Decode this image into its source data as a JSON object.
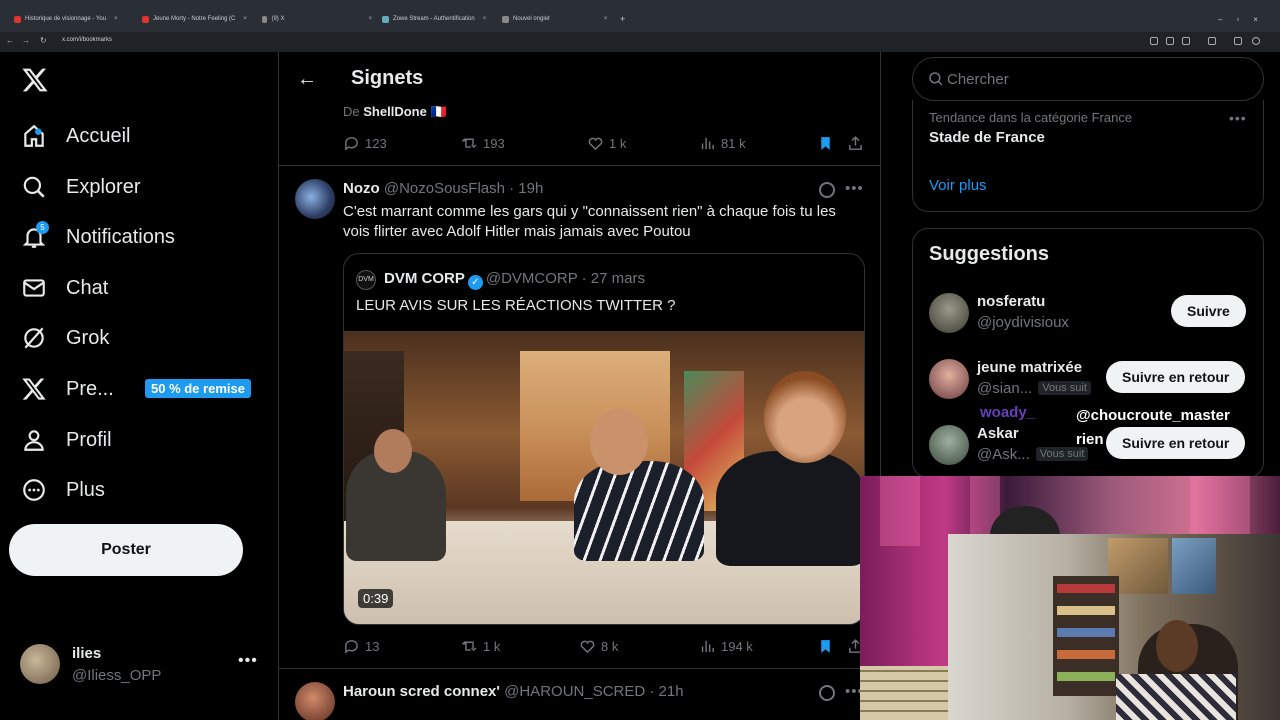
{
  "browser": {
    "tabs": [
      {
        "label": "Historique de visionnage - You",
        "color": "#e33"
      },
      {
        "label": "Jeune Morty - Notre Feeling (C",
        "color": "#e33"
      },
      {
        "label": "(9) X",
        "color": "#888"
      },
      {
        "label": "Zowe Stream - Authentification",
        "color": "#6ab"
      },
      {
        "label": "Nouvel onglet",
        "color": "#888"
      }
    ],
    "url": "x.com/i/bookmarks"
  },
  "sidebar": {
    "items": [
      {
        "label": "Accueil",
        "icon": "home-icon"
      },
      {
        "label": "Explorer",
        "icon": "search-icon"
      },
      {
        "label": "Notifications",
        "icon": "bell-icon"
      },
      {
        "label": "Chat",
        "icon": "mail-icon"
      },
      {
        "label": "Grok",
        "icon": "grok-icon"
      },
      {
        "label": "Pre...",
        "icon": "x-logo-icon"
      },
      {
        "label": "Profil",
        "icon": "person-icon"
      },
      {
        "label": "Plus",
        "icon": "more-circle-icon"
      }
    ],
    "notif_count": "5",
    "premium_badge": "50 % de remise",
    "post_button": "Poster",
    "account": {
      "name": "ilies",
      "handle": "@Iliess_OPP"
    }
  },
  "center": {
    "title": "Signets",
    "prev_tweet": {
      "from_prefix": "De",
      "from_name": "ShellDone",
      "flag": "🇫🇷",
      "replies": "123",
      "retweets": "193",
      "likes": "1 k",
      "views": "81 k"
    },
    "tweet": {
      "name": "Nozo",
      "handle_time": "@NozoSousFlash · 19h",
      "text": "C'est marrant comme les gars qui y \"connaissent rien\" à chaque fois tu les vois flirter avec Adolf Hitler mais jamais avec Poutou",
      "quote": {
        "name": "DVM CORP",
        "handle_time": "@DVMCORP · 27 mars",
        "avatar_text": "DVM",
        "text": "LEUR AVIS SUR LES RÉACTIONS TWITTER ?",
        "duration": "0:39"
      },
      "replies": "13",
      "retweets": "1 k",
      "likes": "8 k",
      "views": "194 k"
    },
    "next_tweet": {
      "name": "Haroun scred connex'",
      "handle_time": "@HAROUN_SCRED · 21h"
    }
  },
  "right": {
    "search_placeholder": "Chercher",
    "trend": {
      "category": "Tendance dans la catégorie France",
      "title": "Stade de France",
      "see_more": "Voir plus"
    },
    "suggestions": {
      "title": "Suggestions",
      "items": [
        {
          "name": "nosferatu",
          "handle": "@joydivisioux",
          "follows_you": "",
          "button": "Suivre"
        },
        {
          "name": "jeune matrixée",
          "handle": "@sian...",
          "follows_you": "Vous suit",
          "button": "Suivre en retour"
        },
        {
          "name": "Askar",
          "handle": "@Ask...",
          "follows_you": "Vous suit",
          "button": "Suivre en retour"
        }
      ]
    }
  },
  "overlay": {
    "chat_name": "@choucroute_master",
    "chat_text": "rien",
    "purple_text": "woady_"
  }
}
